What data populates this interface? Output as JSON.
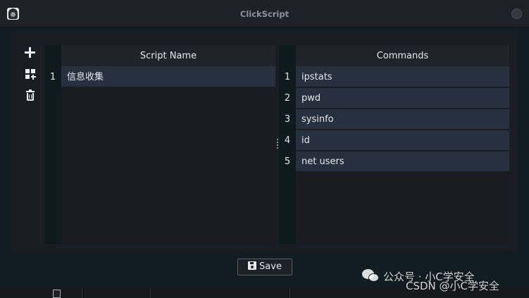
{
  "window": {
    "title": "ClickScript"
  },
  "toolbar": {
    "add_icon": "plus-icon",
    "add_group_icon": "grid-plus-icon",
    "delete_icon": "trash-icon"
  },
  "scripts_table": {
    "header": "Script Name",
    "rows": [
      {
        "num": "1",
        "name": "信息收集"
      }
    ]
  },
  "commands_table": {
    "header": "Commands",
    "rows": [
      {
        "num": "1",
        "command": "ipstats"
      },
      {
        "num": "2",
        "command": "pwd"
      },
      {
        "num": "3",
        "command": "sysinfo"
      },
      {
        "num": "4",
        "command": "id"
      },
      {
        "num": "5",
        "command": "net users"
      }
    ]
  },
  "footer": {
    "save_label": "Save",
    "save_icon": "floppy-disk-icon"
  },
  "watermark": {
    "line1": "公众号 · 小C学安全",
    "line2": "CSDN @小C学安全"
  },
  "colors": {
    "window_bg": "#111d22",
    "panel_bg": "#1a1d23",
    "row_bg": "#27303f",
    "text": "#e6e8eb"
  }
}
